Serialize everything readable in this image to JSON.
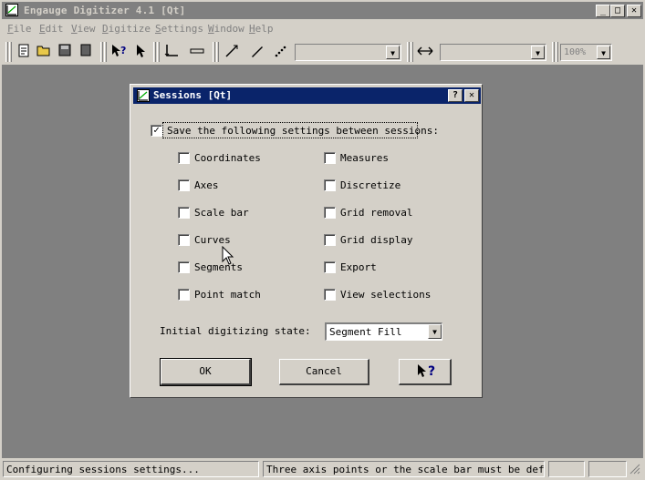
{
  "window": {
    "title": "Engauge Digitizer 4.1 [Qt]",
    "min_glyph": "_",
    "max_glyph": "□",
    "close_glyph": "✕"
  },
  "menu": {
    "items": [
      {
        "key": "F",
        "rest": "ile"
      },
      {
        "key": "E",
        "rest": "dit"
      },
      {
        "key": "V",
        "rest": "iew"
      },
      {
        "key": "D",
        "rest": "igitize"
      },
      {
        "key": "S",
        "rest": "ettings"
      },
      {
        "key": "W",
        "rest": "indow"
      },
      {
        "key": "H",
        "rest": "elp"
      }
    ]
  },
  "toolbar": {
    "zoom_value": "100%",
    "combo_arrow": "▼"
  },
  "dialog": {
    "title": "Sessions  [Qt]",
    "help_glyph": "?",
    "close_glyph": "✕",
    "save_label": "Save the following settings between sessions:",
    "save_checked": true,
    "check_glyph": "✓",
    "left_options": [
      {
        "label": "Coordinates",
        "checked": false
      },
      {
        "label": "Axes",
        "checked": false
      },
      {
        "label": "Scale bar",
        "checked": false
      },
      {
        "label": "Curves",
        "checked": false
      },
      {
        "label": "Segments",
        "checked": false
      },
      {
        "label": "Point match",
        "checked": false
      }
    ],
    "right_options": [
      {
        "label": "Measures",
        "checked": false
      },
      {
        "label": "Discretize",
        "checked": false
      },
      {
        "label": "Grid removal",
        "checked": false
      },
      {
        "label": "Grid display",
        "checked": false
      },
      {
        "label": "Export",
        "checked": false
      },
      {
        "label": "View selections",
        "checked": false
      }
    ],
    "initial_state_label": "Initial digitizing state:",
    "initial_state_value": "Segment Fill",
    "ok_label": "OK",
    "cancel_label": "Cancel",
    "whats_this_glyph": "?"
  },
  "status": {
    "left": "Configuring sessions settings...",
    "right": "Three axis points or the scale bar must be defined."
  }
}
